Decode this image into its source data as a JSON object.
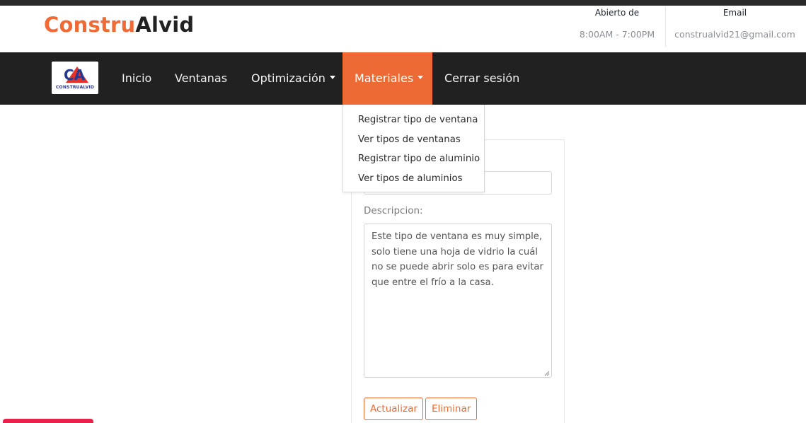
{
  "header": {
    "brand_part1": "Constru",
    "brand_part2": "Alvid",
    "hours_label": "Abierto de",
    "hours_value": "8:00AM - 7:00PM",
    "email_label": "Email",
    "email_value": "construalvid21@gmail.com"
  },
  "navbar": {
    "logo_mark": "CA",
    "logo_text": "CONSTRUALVID",
    "items": [
      {
        "label": "Inicio"
      },
      {
        "label": "Ventanas"
      },
      {
        "label": "Optimización"
      },
      {
        "label": "Materiales"
      },
      {
        "label": "Cerrar sesión"
      }
    ]
  },
  "dropdown": {
    "items": [
      {
        "label": "Registrar tipo de ventana"
      },
      {
        "label": "Ver tipos de ventanas"
      },
      {
        "label": "Registrar tipo de aluminio"
      },
      {
        "label": "Ver tipos de aluminios"
      }
    ]
  },
  "form": {
    "description_label": "Descripcion:",
    "description_value": "Este tipo de ventana es muy simple, solo tiene una hoja de vidrio la cuál no se puede abrir solo es para evitar que entre el frío a la casa.",
    "update_label": "Actualizar",
    "delete_label": "Eliminar"
  },
  "colors": {
    "accent": "#ee6a35",
    "navbar_bg": "#212121",
    "pink": "#e8224a"
  }
}
